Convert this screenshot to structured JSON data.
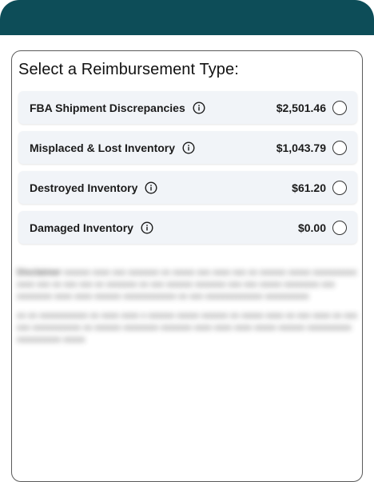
{
  "card": {
    "title": "Select a Reimbursement Type:"
  },
  "options": [
    {
      "label": "FBA Shipment Discrepancies",
      "amount": "$2,501.46",
      "selected": false
    },
    {
      "label": "Misplaced & Lost Inventory",
      "amount": "$1,043.79",
      "selected": false
    },
    {
      "label": "Destroyed Inventory",
      "amount": "$61.20",
      "selected": false
    },
    {
      "label": "Damaged Inventory",
      "amount": "$0.00",
      "selected": false
    }
  ],
  "icons": {
    "info": "info-circle-icon"
  },
  "colors": {
    "header": "#0d4d58",
    "option_background": "#f1f4f8",
    "text": "#1b1b1b"
  }
}
